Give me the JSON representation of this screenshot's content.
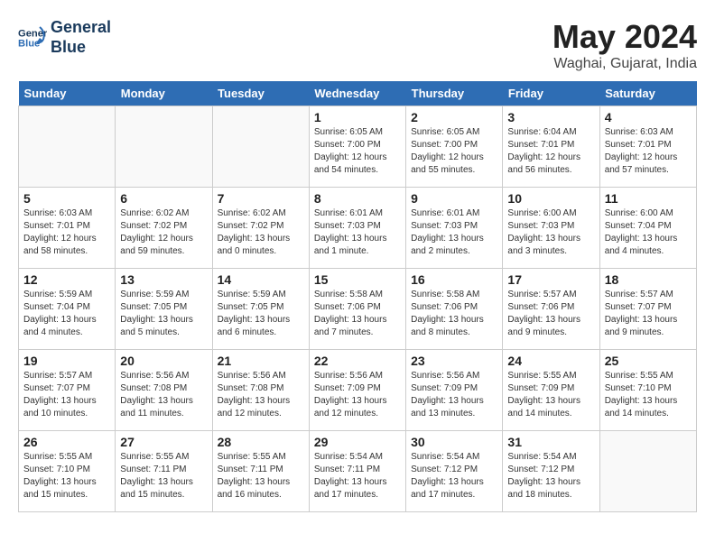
{
  "logo": {
    "line1": "General",
    "line2": "Blue"
  },
  "title": "May 2024",
  "location": "Waghai, Gujarat, India",
  "days_of_week": [
    "Sunday",
    "Monday",
    "Tuesday",
    "Wednesday",
    "Thursday",
    "Friday",
    "Saturday"
  ],
  "weeks": [
    [
      {
        "day": "",
        "info": ""
      },
      {
        "day": "",
        "info": ""
      },
      {
        "day": "",
        "info": ""
      },
      {
        "day": "1",
        "info": "Sunrise: 6:05 AM\nSunset: 7:00 PM\nDaylight: 12 hours\nand 54 minutes."
      },
      {
        "day": "2",
        "info": "Sunrise: 6:05 AM\nSunset: 7:00 PM\nDaylight: 12 hours\nand 55 minutes."
      },
      {
        "day": "3",
        "info": "Sunrise: 6:04 AM\nSunset: 7:01 PM\nDaylight: 12 hours\nand 56 minutes."
      },
      {
        "day": "4",
        "info": "Sunrise: 6:03 AM\nSunset: 7:01 PM\nDaylight: 12 hours\nand 57 minutes."
      }
    ],
    [
      {
        "day": "5",
        "info": "Sunrise: 6:03 AM\nSunset: 7:01 PM\nDaylight: 12 hours\nand 58 minutes."
      },
      {
        "day": "6",
        "info": "Sunrise: 6:02 AM\nSunset: 7:02 PM\nDaylight: 12 hours\nand 59 minutes."
      },
      {
        "day": "7",
        "info": "Sunrise: 6:02 AM\nSunset: 7:02 PM\nDaylight: 13 hours\nand 0 minutes."
      },
      {
        "day": "8",
        "info": "Sunrise: 6:01 AM\nSunset: 7:03 PM\nDaylight: 13 hours\nand 1 minute."
      },
      {
        "day": "9",
        "info": "Sunrise: 6:01 AM\nSunset: 7:03 PM\nDaylight: 13 hours\nand 2 minutes."
      },
      {
        "day": "10",
        "info": "Sunrise: 6:00 AM\nSunset: 7:03 PM\nDaylight: 13 hours\nand 3 minutes."
      },
      {
        "day": "11",
        "info": "Sunrise: 6:00 AM\nSunset: 7:04 PM\nDaylight: 13 hours\nand 4 minutes."
      }
    ],
    [
      {
        "day": "12",
        "info": "Sunrise: 5:59 AM\nSunset: 7:04 PM\nDaylight: 13 hours\nand 4 minutes."
      },
      {
        "day": "13",
        "info": "Sunrise: 5:59 AM\nSunset: 7:05 PM\nDaylight: 13 hours\nand 5 minutes."
      },
      {
        "day": "14",
        "info": "Sunrise: 5:59 AM\nSunset: 7:05 PM\nDaylight: 13 hours\nand 6 minutes."
      },
      {
        "day": "15",
        "info": "Sunrise: 5:58 AM\nSunset: 7:06 PM\nDaylight: 13 hours\nand 7 minutes."
      },
      {
        "day": "16",
        "info": "Sunrise: 5:58 AM\nSunset: 7:06 PM\nDaylight: 13 hours\nand 8 minutes."
      },
      {
        "day": "17",
        "info": "Sunrise: 5:57 AM\nSunset: 7:06 PM\nDaylight: 13 hours\nand 9 minutes."
      },
      {
        "day": "18",
        "info": "Sunrise: 5:57 AM\nSunset: 7:07 PM\nDaylight: 13 hours\nand 9 minutes."
      }
    ],
    [
      {
        "day": "19",
        "info": "Sunrise: 5:57 AM\nSunset: 7:07 PM\nDaylight: 13 hours\nand 10 minutes."
      },
      {
        "day": "20",
        "info": "Sunrise: 5:56 AM\nSunset: 7:08 PM\nDaylight: 13 hours\nand 11 minutes."
      },
      {
        "day": "21",
        "info": "Sunrise: 5:56 AM\nSunset: 7:08 PM\nDaylight: 13 hours\nand 12 minutes."
      },
      {
        "day": "22",
        "info": "Sunrise: 5:56 AM\nSunset: 7:09 PM\nDaylight: 13 hours\nand 12 minutes."
      },
      {
        "day": "23",
        "info": "Sunrise: 5:56 AM\nSunset: 7:09 PM\nDaylight: 13 hours\nand 13 minutes."
      },
      {
        "day": "24",
        "info": "Sunrise: 5:55 AM\nSunset: 7:09 PM\nDaylight: 13 hours\nand 14 minutes."
      },
      {
        "day": "25",
        "info": "Sunrise: 5:55 AM\nSunset: 7:10 PM\nDaylight: 13 hours\nand 14 minutes."
      }
    ],
    [
      {
        "day": "26",
        "info": "Sunrise: 5:55 AM\nSunset: 7:10 PM\nDaylight: 13 hours\nand 15 minutes."
      },
      {
        "day": "27",
        "info": "Sunrise: 5:55 AM\nSunset: 7:11 PM\nDaylight: 13 hours\nand 15 minutes."
      },
      {
        "day": "28",
        "info": "Sunrise: 5:55 AM\nSunset: 7:11 PM\nDaylight: 13 hours\nand 16 minutes."
      },
      {
        "day": "29",
        "info": "Sunrise: 5:54 AM\nSunset: 7:11 PM\nDaylight: 13 hours\nand 17 minutes."
      },
      {
        "day": "30",
        "info": "Sunrise: 5:54 AM\nSunset: 7:12 PM\nDaylight: 13 hours\nand 17 minutes."
      },
      {
        "day": "31",
        "info": "Sunrise: 5:54 AM\nSunset: 7:12 PM\nDaylight: 13 hours\nand 18 minutes."
      },
      {
        "day": "",
        "info": ""
      }
    ]
  ]
}
